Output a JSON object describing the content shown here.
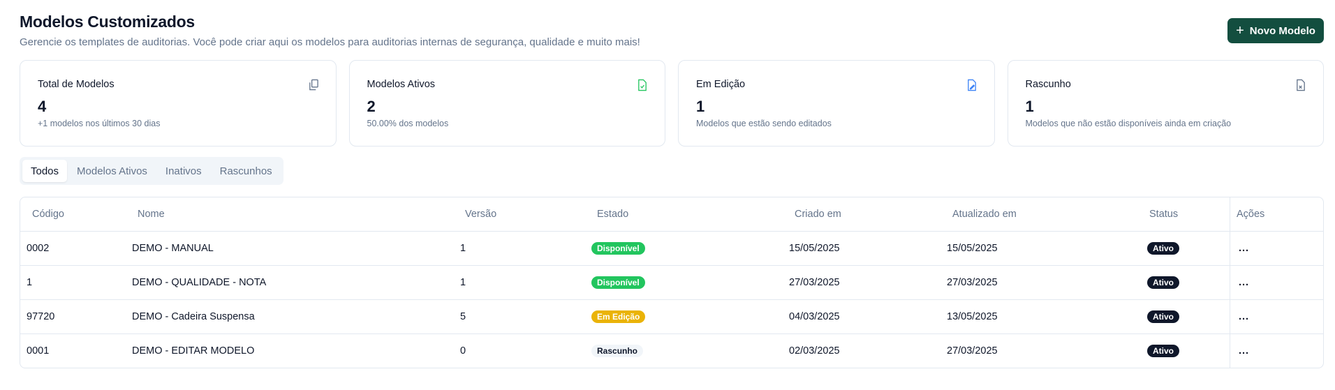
{
  "header": {
    "title": "Modelos Customizados",
    "subtitle": "Gerencie os templates de auditorias. Você pode criar aqui os modelos para auditorias internas de segurança, qualidade e muito mais!",
    "new_button": "Novo Modelo"
  },
  "cards": [
    {
      "label": "Total de Modelos",
      "value": "4",
      "sub": "+1 modelos nos últimos 30 dias",
      "icon": "copy-icon",
      "color": "#64748b"
    },
    {
      "label": "Modelos Ativos",
      "value": "2",
      "sub": "50.00% dos modelos",
      "icon": "file-check-icon",
      "color": "#22c55e"
    },
    {
      "label": "Em Edição",
      "value": "1",
      "sub": "Modelos que estão sendo editados",
      "icon": "file-edit-icon",
      "color": "#3b82f6"
    },
    {
      "label": "Rascunho",
      "value": "1",
      "sub": "Modelos que não estão disponíveis ainda em criação",
      "icon": "file-x-icon",
      "color": "#64748b"
    }
  ],
  "tabs": [
    {
      "label": "Todos",
      "active": true
    },
    {
      "label": "Modelos Ativos"
    },
    {
      "label": "Inativos"
    },
    {
      "label": "Rascunhos"
    }
  ],
  "table": {
    "columns": [
      "Código",
      "Nome",
      "Versão",
      "Estado",
      "Criado em",
      "Atualizado em",
      "Status",
      "Ações"
    ],
    "rows": [
      {
        "codigo": "0002",
        "nome": "DEMO - MANUAL",
        "versao": "1",
        "estado": "Disponível",
        "criado": "15/05/2025",
        "atualizado": "15/05/2025",
        "status": "Ativo"
      },
      {
        "codigo": "1",
        "nome": "DEMO - QUALIDADE - NOTA",
        "versao": "1",
        "estado": "Disponível",
        "criado": "27/03/2025",
        "atualizado": "27/03/2025",
        "status": "Ativo"
      },
      {
        "codigo": "97720",
        "nome": "DEMO - Cadeira Suspensa",
        "versao": "5",
        "estado": "Em Edição",
        "criado": "04/03/2025",
        "atualizado": "13/05/2025",
        "status": "Ativo"
      },
      {
        "codigo": "0001",
        "nome": "DEMO - EDITAR MODELO",
        "versao": "0",
        "estado": "Rascunho",
        "criado": "02/03/2025",
        "atualizado": "27/03/2025",
        "status": "Ativo"
      }
    ],
    "actions_label": "..."
  },
  "colors": {
    "primary": "#134e3f",
    "disponivel": "#22c55e",
    "em_edicao": "#eab308",
    "rascunho": "#f1f5f9",
    "ativo": "#0f172a"
  }
}
